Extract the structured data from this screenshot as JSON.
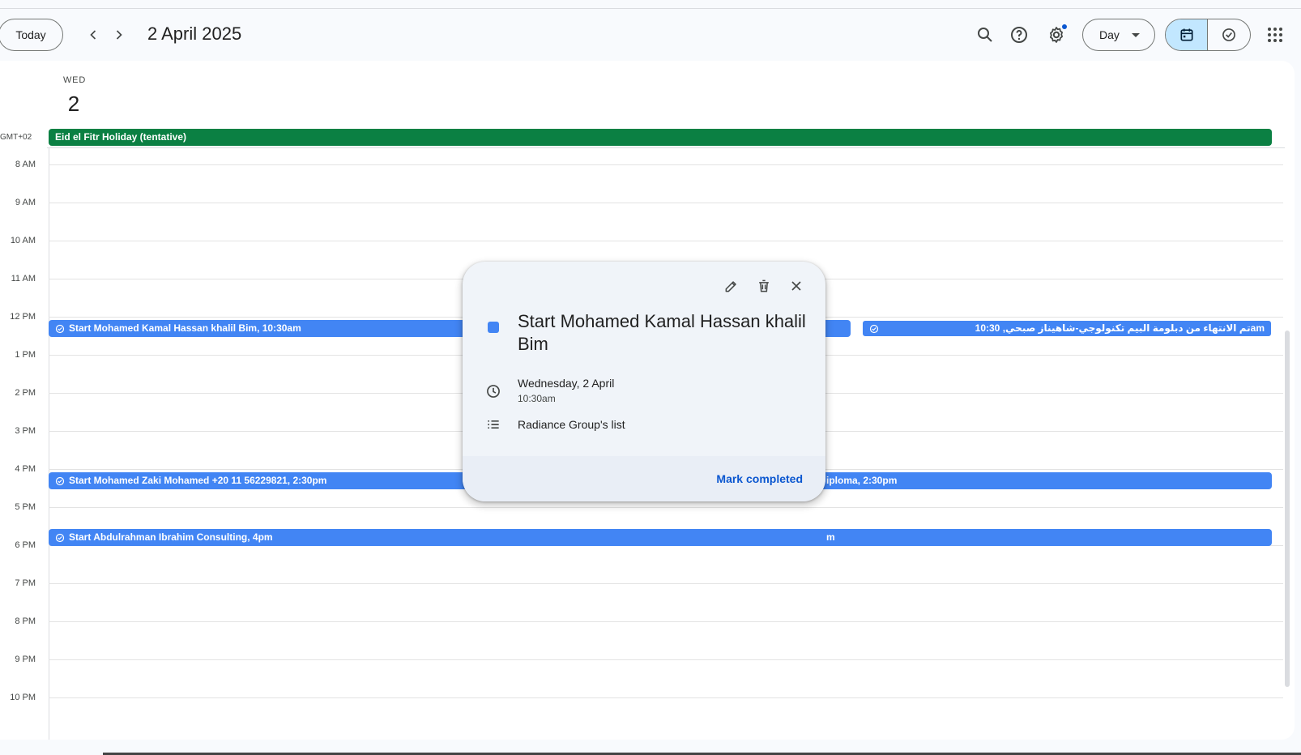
{
  "header": {
    "today_label": "Today",
    "date_title": "2 April 2025",
    "view_label": "Day"
  },
  "day": {
    "name": "WED",
    "number": "2"
  },
  "timezone": "GMT+02",
  "allday_event": "Eid el Fitr Holiday (tentative)",
  "hours": [
    "8 AM",
    "9 AM",
    "10 AM",
    "11 AM",
    "12 PM",
    "1 PM",
    "2 PM",
    "3 PM",
    "4 PM",
    "5 PM",
    "6 PM",
    "7 PM",
    "8 PM",
    "9 PM",
    "10 PM"
  ],
  "tasks": {
    "t1": "Start Mohamed Kamal Hassan khalil Bim, 10:30am",
    "t1_rtl": "تم الانتهاء من دبلومة البيم تكنولوجي-شاهيناز صبحي, 10:30am",
    "t2": "Start Mohamed Zaki Mohamed +20 11 56229821, 2:30pm",
    "t2_right": "iploma, 2:30pm",
    "t3": "Start Abdulrahman Ibrahim Consulting, 4pm",
    "t3_right": "m"
  },
  "popup": {
    "title": "Start Mohamed Kamal Hassan khalil Bim",
    "date": "Wednesday, 2 April",
    "time": "10:30am",
    "list": "Radiance Group's list",
    "mark_completed": "Mark completed"
  },
  "colors": {
    "task_blue": "#4285f4",
    "holiday_green": "#0b8043",
    "accent": "#0b57d0",
    "selected_segment": "#c2e7ff"
  }
}
